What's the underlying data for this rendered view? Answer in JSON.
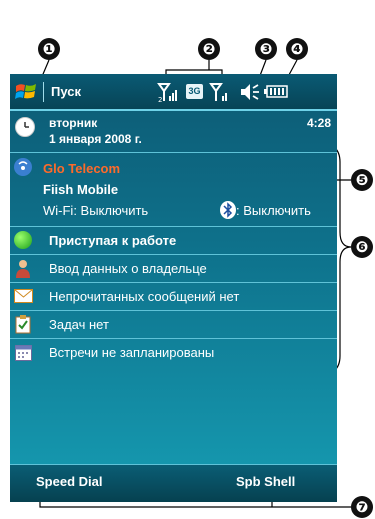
{
  "callouts": [
    "❶",
    "❷",
    "❸",
    "❹",
    "❺",
    "❻",
    "❼"
  ],
  "titlebar": {
    "start_label": "Пуск",
    "network_3g": "3G"
  },
  "date": {
    "weekday": "вторник",
    "full_date": "1 января 2008 г.",
    "time": "4:28"
  },
  "carrier": {
    "line1": "Glo Telecom",
    "line2": "Fiish Mobile",
    "wifi": "Wi-Fi: Выключить",
    "bluetooth": ": Выключить"
  },
  "items": [
    {
      "label": "Приступая к работе",
      "icon": "getting-started-icon"
    },
    {
      "label": "Ввод данных о владельце",
      "icon": "owner-icon"
    },
    {
      "label": "Непрочитанных сообщений нет",
      "icon": "envelope-icon"
    },
    {
      "label": "Задач нет",
      "icon": "tasks-icon"
    },
    {
      "label": "Встречи не запланированы",
      "icon": "calendar-icon"
    }
  ],
  "softkeys": {
    "left": "Speed Dial",
    "right": "Spb Shell"
  },
  "colors": {
    "carrier_accent": "#ff6a2a",
    "background": "#0c6f86",
    "divider": "#5fc3d8"
  }
}
